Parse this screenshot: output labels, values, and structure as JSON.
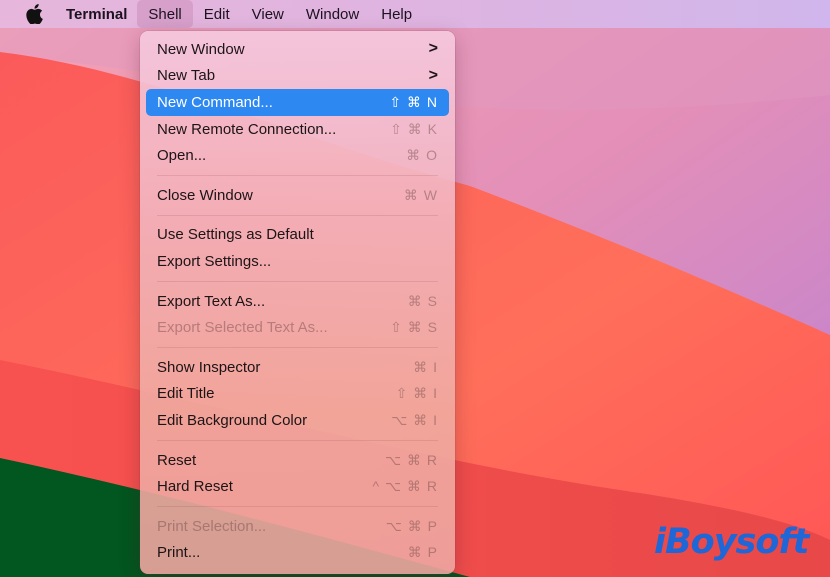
{
  "menubar": {
    "apple_icon": "apple-logo-icon",
    "app_name": "Terminal",
    "items": [
      {
        "label": "Shell",
        "open": true
      },
      {
        "label": "Edit"
      },
      {
        "label": "View"
      },
      {
        "label": "Window"
      },
      {
        "label": "Help"
      }
    ]
  },
  "shell_menu": {
    "groups": [
      [
        {
          "label": "New Window",
          "submenu": true,
          "chevron": ">"
        },
        {
          "label": "New Tab",
          "submenu": true,
          "chevron": ">"
        },
        {
          "label": "New Command...",
          "shortcut": "⇧ ⌘ N",
          "highlighted": true
        },
        {
          "label": "New Remote Connection...",
          "shortcut": "⇧ ⌘ K"
        },
        {
          "label": "Open...",
          "shortcut": "⌘ O"
        }
      ],
      [
        {
          "label": "Close Window",
          "shortcut": "⌘ W"
        }
      ],
      [
        {
          "label": "Use Settings as Default"
        },
        {
          "label": "Export Settings..."
        }
      ],
      [
        {
          "label": "Export Text As...",
          "shortcut": "⌘ S"
        },
        {
          "label": "Export Selected Text As...",
          "shortcut": "⇧ ⌘ S",
          "disabled": true
        }
      ],
      [
        {
          "label": "Show Inspector",
          "shortcut": "⌘ I"
        },
        {
          "label": "Edit Title",
          "shortcut": "⇧ ⌘ I"
        },
        {
          "label": "Edit Background Color",
          "shortcut": "⌥ ⌘ I"
        }
      ],
      [
        {
          "label": "Reset",
          "shortcut": "⌥ ⌘ R"
        },
        {
          "label": "Hard Reset",
          "shortcut": "^ ⌥ ⌘ R"
        }
      ],
      [
        {
          "label": "Print Selection...",
          "shortcut": "⌥ ⌘ P",
          "disabled": true
        },
        {
          "label": "Print...",
          "shortcut": "⌘ P"
        }
      ]
    ]
  },
  "colors": {
    "highlight": "#2d88f2",
    "watermark": "#1f66d6"
  },
  "watermark": {
    "text": "iBoysoft"
  }
}
